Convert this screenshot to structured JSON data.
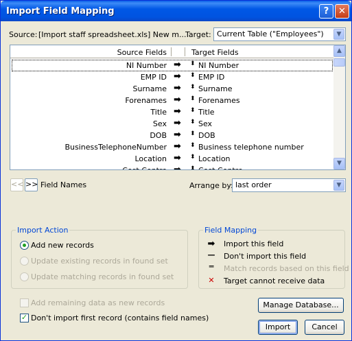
{
  "window": {
    "title": "Import Field Mapping",
    "help_label": "?",
    "close_label": "✕"
  },
  "source": {
    "label": "Source:",
    "value": "[Import staff spreadsheet.xls] New m..."
  },
  "target": {
    "label": "Target:",
    "value": "Current Table (\"Employees\")"
  },
  "grid": {
    "header_source": "Source Fields",
    "header_target": "Target Fields",
    "rows": [
      {
        "source": "NI Number",
        "target": "NI Number"
      },
      {
        "source": "EMP ID",
        "target": "EMP ID"
      },
      {
        "source": "Surname",
        "target": "Surname"
      },
      {
        "source": "Forenames",
        "target": "Forenames"
      },
      {
        "source": "Title",
        "target": "Title"
      },
      {
        "source": "Sex",
        "target": "Sex"
      },
      {
        "source": "DOB",
        "target": "DOB"
      },
      {
        "source": "BusinessTelephoneNumber",
        "target": "Business telephone number"
      },
      {
        "source": "Location",
        "target": "Location"
      },
      {
        "source": "Cost Centre",
        "target": "Cost Centre"
      }
    ]
  },
  "nav": {
    "prev_label": "<<",
    "next_label": ">>",
    "field_names_label": "Field Names"
  },
  "arrange": {
    "label": "Arrange by:",
    "value": "last order"
  },
  "import_action": {
    "title": "Import Action",
    "options": [
      {
        "label": "Add new records",
        "selected": true,
        "enabled": true
      },
      {
        "label": "Update existing records in found set",
        "selected": false,
        "enabled": false
      },
      {
        "label": "Update matching records in found set",
        "selected": false,
        "enabled": false
      }
    ]
  },
  "field_mapping": {
    "title": "Field Mapping",
    "items": [
      {
        "icon": "import-arrow-icon",
        "label": "Import this field",
        "enabled": true
      },
      {
        "icon": "dont-import-icon",
        "label": "Don't import this field",
        "enabled": true
      },
      {
        "icon": "match-icon",
        "label": "Match records based on this field",
        "enabled": false
      },
      {
        "icon": "cannot-receive-icon",
        "label": "Target cannot receive data",
        "enabled": true
      }
    ]
  },
  "checkboxes": {
    "add_remaining": {
      "label": "Add remaining data as new records",
      "checked": false,
      "enabled": false
    },
    "dont_import_first": {
      "label": "Don't import first record (contains field names)",
      "checked": true,
      "enabled": true
    }
  },
  "buttons": {
    "manage_database": "Manage Database...",
    "import": "Import",
    "cancel": "Cancel"
  },
  "colors": {
    "group_title": "#0046D5",
    "radio_dot": "#21A121",
    "cannot_receive": "#CC0000"
  }
}
